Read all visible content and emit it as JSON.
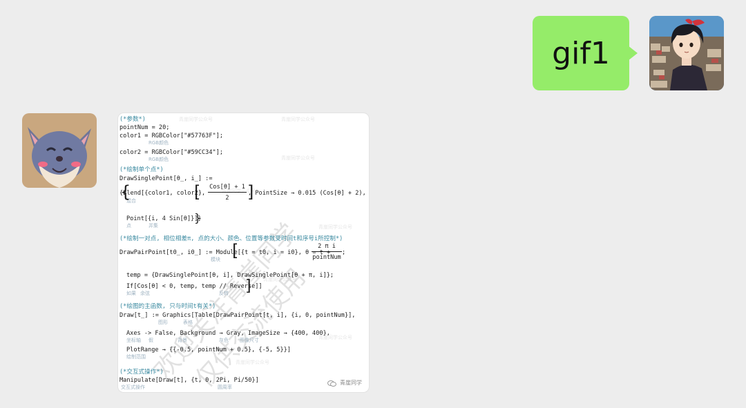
{
  "chat": {
    "self_message": {
      "text": "gif1"
    },
    "peer_image": {
      "code_lines": [
        "(*参数*)",
        "pointNum = 20;",
        "color1 = RGBColor[\"#57763F\"];",
        "color2 = RGBColor[\"#59CC34\"];",
        "(*绘制单个点*)",
        "DrawSinglePoint[θ_, i_] :=",
        "{Blend[{color1, color2},",
        ", PointSize → 0.015 (Cos[θ] + 2),",
        "Point[{i, 4 Sin[θ]}]}",
        "(*绘制一对点, 相位相差π, 点的大小、颜色、位置等参数受时间t和序号i所控制*)",
        "DrawPairPoint[t0_, i0_] := Module[{t = t0, i = i0}, θ = t +",
        ";",
        "temp = {DrawSinglePoint[θ, i], DrawSinglePoint[θ + π, i]};",
        "If[Cos[θ] < 0, temp, temp // Reverse]]",
        "(*绘图的主函数, 只与时间t有关*)",
        "Draw[t_] := Graphics[Table[DrawPairPoint[t, i], {i, 0, pointNum}],",
        "Axes -> False, Background → Gray, ImageSize → {400, 400},",
        "PlotRange → {{-0.5, pointNum + 0.5}, {-5, 5}}]",
        "(*交互式操作*)",
        "Manipulate[Draw[t], {t, 0, 2Pi, Pi/50}]"
      ],
      "fractions": {
        "blend_num": "Cos[θ] + 1",
        "blend_den": "2",
        "theta_num": "2 π i",
        "theta_den": "pointNum"
      },
      "hints": [
        "RGB颜色",
        "RGB颜色",
        "混合",
        "点",
        "并集",
        "模块",
        "如果",
        "余弦",
        "反转",
        "图形",
        "表格",
        "坐标轴",
        "假",
        "背景",
        "灰色",
        "图像尺寸",
        "绘制范围",
        "交互式操作",
        "圆周率"
      ],
      "watermark_large": "欢迎关注青崖同学",
      "watermark_large_2": "仅供交流使用",
      "watermark_small": "青崖同学公众号",
      "caption": "青崖同学"
    }
  },
  "colors": {
    "background": "#ededed",
    "self_bubble": "#95ec69",
    "comment": "#3b8aa0"
  },
  "icons": {
    "self_avatar": "anime-girl-avatar",
    "peer_avatar": "cartoon-cat-avatar",
    "caption_logo": "wechat-logo-icon"
  }
}
